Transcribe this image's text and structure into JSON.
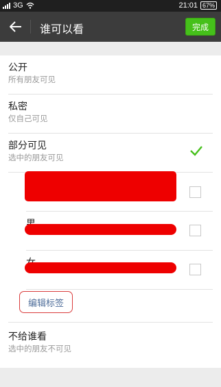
{
  "status_bar": {
    "network": "3G",
    "time": "21:01",
    "battery": "67%"
  },
  "header": {
    "title": "谁可以看",
    "done_label": "完成"
  },
  "options": [
    {
      "label": "公开",
      "description": "所有朋友可见"
    },
    {
      "label": "私密",
      "description": "仅自己可见"
    },
    {
      "label": "部分可见",
      "description": "选中的朋友可见",
      "selected": true
    },
    {
      "label": "不给谁看",
      "description": "选中的朋友不可见"
    }
  ],
  "tags": [
    {
      "label": "",
      "checked": false
    },
    {
      "label": "男",
      "checked": false
    },
    {
      "label": "女",
      "checked": false
    }
  ],
  "edit_tags_label": "编辑标签",
  "colors": {
    "accent": "#45c01a",
    "titlebar": "#3c3c3c",
    "redaction": "#ee0000",
    "link": "#4f6e9a",
    "highlight_box": "#d93a3a"
  }
}
